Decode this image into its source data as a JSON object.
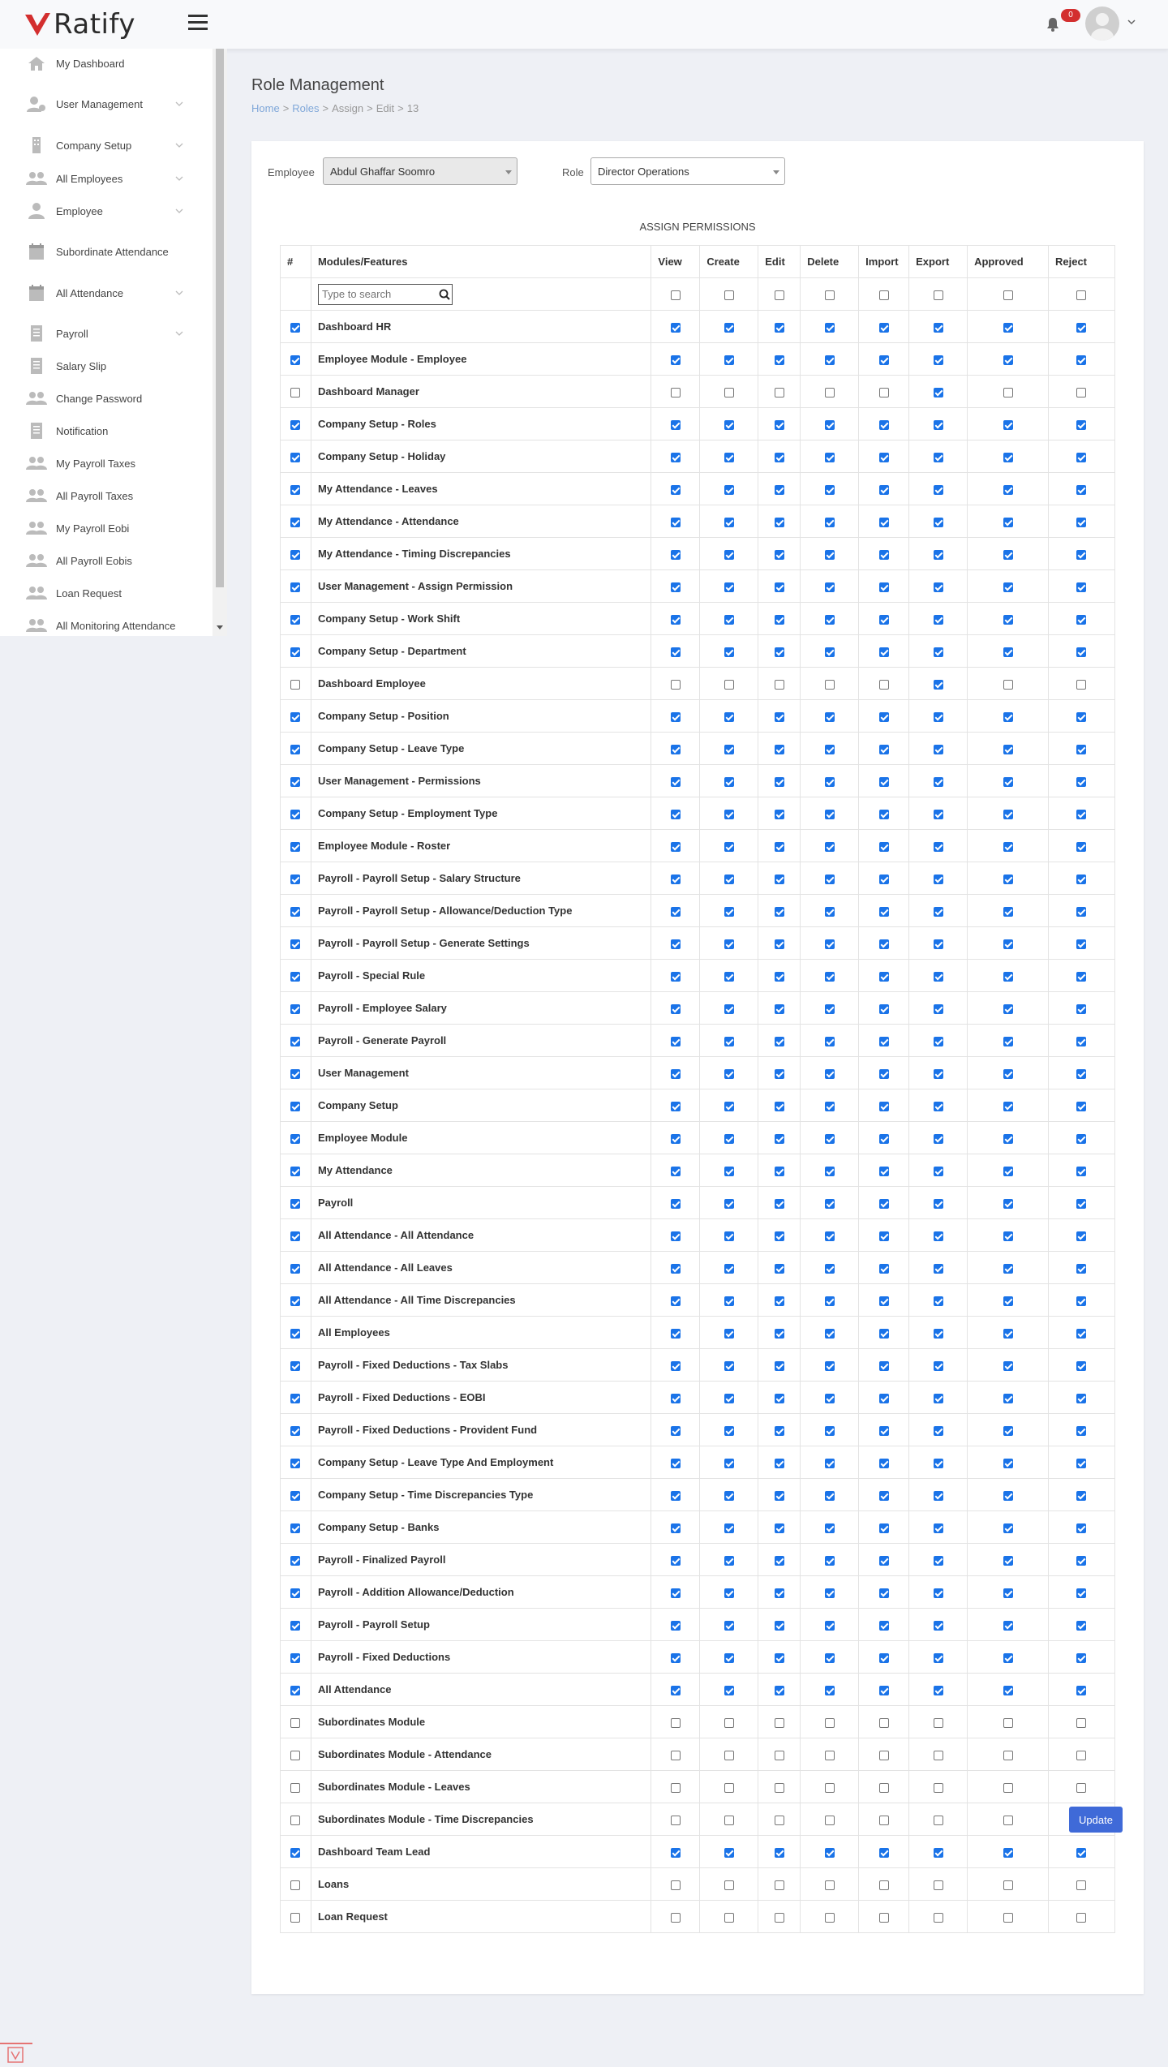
{
  "app": {
    "brand": "Ratify",
    "notification_count": "0",
    "accent": "#d32f2f"
  },
  "sidebar": {
    "items": [
      {
        "label": "My Dashboard",
        "icon": "home-icon",
        "chevron": false
      },
      {
        "label": "User Management",
        "icon": "user-cog-icon",
        "chevron": true
      },
      {
        "label": "Company Setup",
        "icon": "building-icon",
        "chevron": true
      },
      {
        "label": "All Employees",
        "icon": "users-icon",
        "chevron": true
      },
      {
        "label": "Employee",
        "icon": "user-icon",
        "chevron": true
      },
      {
        "label": "Subordinate Attendance",
        "icon": "calendar-icon",
        "chevron": false
      },
      {
        "label": "All Attendance",
        "icon": "calendar-icon",
        "chevron": true
      },
      {
        "label": "Payroll",
        "icon": "file-icon",
        "chevron": true
      },
      {
        "label": "Salary Slip",
        "icon": "file-icon",
        "chevron": false
      },
      {
        "label": "Change Password",
        "icon": "users-icon",
        "chevron": false
      },
      {
        "label": "Notification",
        "icon": "file-icon",
        "chevron": false
      },
      {
        "label": "My Payroll Taxes",
        "icon": "users-icon",
        "chevron": false
      },
      {
        "label": "All Payroll Taxes",
        "icon": "users-icon",
        "chevron": false
      },
      {
        "label": "My Payroll Eobi",
        "icon": "users-icon",
        "chevron": false
      },
      {
        "label": "All Payroll Eobis",
        "icon": "users-icon",
        "chevron": false
      },
      {
        "label": "Loan Request",
        "icon": "users-icon",
        "chevron": false
      },
      {
        "label": "All Monitoring Attendance",
        "icon": "users-icon",
        "chevron": false
      }
    ]
  },
  "page": {
    "title": "Role Management",
    "breadcrumb": [
      "Home",
      "Roles",
      "Assign",
      "Edit",
      "13"
    ]
  },
  "form": {
    "employee_label": "Employee",
    "employee_value": "Abdul Ghaffar Soomro",
    "role_label": "Role",
    "role_value": "Director Operations",
    "section_title": "ASSIGN PERMISSIONS",
    "search_placeholder": "Type to search",
    "update_label": "Update"
  },
  "table": {
    "headers": [
      "#",
      "Modules/Features",
      "View",
      "Create",
      "Edit",
      "Delete",
      "Import",
      "Export",
      "Approved",
      "Reject"
    ],
    "rows": [
      {
        "name": "Dashboard HR",
        "row": true,
        "perms": [
          true,
          true,
          true,
          true,
          true,
          true,
          true,
          true
        ]
      },
      {
        "name": "Employee Module - Employee",
        "row": true,
        "perms": [
          true,
          true,
          true,
          true,
          true,
          true,
          true,
          true
        ]
      },
      {
        "name": "Dashboard Manager",
        "row": false,
        "perms": [
          false,
          false,
          false,
          false,
          false,
          true,
          false,
          false
        ]
      },
      {
        "name": "Company Setup - Roles",
        "row": true,
        "perms": [
          true,
          true,
          true,
          true,
          true,
          true,
          true,
          true
        ]
      },
      {
        "name": "Company Setup - Holiday",
        "row": true,
        "perms": [
          true,
          true,
          true,
          true,
          true,
          true,
          true,
          true
        ]
      },
      {
        "name": "My Attendance - Leaves",
        "row": true,
        "perms": [
          true,
          true,
          true,
          true,
          true,
          true,
          true,
          true
        ]
      },
      {
        "name": "My Attendance - Attendance",
        "row": true,
        "perms": [
          true,
          true,
          true,
          true,
          true,
          true,
          true,
          true
        ]
      },
      {
        "name": "My Attendance - Timing Discrepancies",
        "row": true,
        "perms": [
          true,
          true,
          true,
          true,
          true,
          true,
          true,
          true
        ]
      },
      {
        "name": "User Management - Assign Permission",
        "row": true,
        "perms": [
          true,
          true,
          true,
          true,
          true,
          true,
          true,
          true
        ]
      },
      {
        "name": "Company Setup - Work Shift",
        "row": true,
        "perms": [
          true,
          true,
          true,
          true,
          true,
          true,
          true,
          true
        ]
      },
      {
        "name": "Company Setup - Department",
        "row": true,
        "perms": [
          true,
          true,
          true,
          true,
          true,
          true,
          true,
          true
        ]
      },
      {
        "name": "Dashboard Employee",
        "row": false,
        "perms": [
          false,
          false,
          false,
          false,
          false,
          true,
          false,
          false
        ]
      },
      {
        "name": "Company Setup - Position",
        "row": true,
        "perms": [
          true,
          true,
          true,
          true,
          true,
          true,
          true,
          true
        ]
      },
      {
        "name": "Company Setup - Leave Type",
        "row": true,
        "perms": [
          true,
          true,
          true,
          true,
          true,
          true,
          true,
          true
        ]
      },
      {
        "name": "User Management - Permissions",
        "row": true,
        "perms": [
          true,
          true,
          true,
          true,
          true,
          true,
          true,
          true
        ]
      },
      {
        "name": "Company Setup - Employment Type",
        "row": true,
        "perms": [
          true,
          true,
          true,
          true,
          true,
          true,
          true,
          true
        ]
      },
      {
        "name": "Employee Module - Roster",
        "row": true,
        "perms": [
          true,
          true,
          true,
          true,
          true,
          true,
          true,
          true
        ]
      },
      {
        "name": "Payroll - Payroll Setup - Salary Structure",
        "row": true,
        "perms": [
          true,
          true,
          true,
          true,
          true,
          true,
          true,
          true
        ]
      },
      {
        "name": "Payroll - Payroll Setup - Allowance/Deduction Type",
        "row": true,
        "perms": [
          true,
          true,
          true,
          true,
          true,
          true,
          true,
          true
        ]
      },
      {
        "name": "Payroll - Payroll Setup - Generate Settings",
        "row": true,
        "perms": [
          true,
          true,
          true,
          true,
          true,
          true,
          true,
          true
        ]
      },
      {
        "name": "Payroll - Special Rule",
        "row": true,
        "perms": [
          true,
          true,
          true,
          true,
          true,
          true,
          true,
          true
        ]
      },
      {
        "name": "Payroll - Employee Salary",
        "row": true,
        "perms": [
          true,
          true,
          true,
          true,
          true,
          true,
          true,
          true
        ]
      },
      {
        "name": "Payroll - Generate Payroll",
        "row": true,
        "perms": [
          true,
          true,
          true,
          true,
          true,
          true,
          true,
          true
        ]
      },
      {
        "name": "User Management",
        "row": true,
        "perms": [
          true,
          true,
          true,
          true,
          true,
          true,
          true,
          true
        ]
      },
      {
        "name": "Company Setup",
        "row": true,
        "perms": [
          true,
          true,
          true,
          true,
          true,
          true,
          true,
          true
        ]
      },
      {
        "name": "Employee Module",
        "row": true,
        "perms": [
          true,
          true,
          true,
          true,
          true,
          true,
          true,
          true
        ]
      },
      {
        "name": "My Attendance",
        "row": true,
        "perms": [
          true,
          true,
          true,
          true,
          true,
          true,
          true,
          true
        ]
      },
      {
        "name": "Payroll",
        "row": true,
        "perms": [
          true,
          true,
          true,
          true,
          true,
          true,
          true,
          true
        ]
      },
      {
        "name": "All Attendance - All Attendance",
        "row": true,
        "perms": [
          true,
          true,
          true,
          true,
          true,
          true,
          true,
          true
        ]
      },
      {
        "name": "All Attendance - All Leaves",
        "row": true,
        "perms": [
          true,
          true,
          true,
          true,
          true,
          true,
          true,
          true
        ]
      },
      {
        "name": "All Attendance - All Time Discrepancies",
        "row": true,
        "perms": [
          true,
          true,
          true,
          true,
          true,
          true,
          true,
          true
        ]
      },
      {
        "name": "All Employees",
        "row": true,
        "perms": [
          true,
          true,
          true,
          true,
          true,
          true,
          true,
          true
        ]
      },
      {
        "name": "Payroll - Fixed Deductions - Tax Slabs",
        "row": true,
        "perms": [
          true,
          true,
          true,
          true,
          true,
          true,
          true,
          true
        ]
      },
      {
        "name": "Payroll - Fixed Deductions - EOBI",
        "row": true,
        "perms": [
          true,
          true,
          true,
          true,
          true,
          true,
          true,
          true
        ]
      },
      {
        "name": "Payroll - Fixed Deductions - Provident Fund",
        "row": true,
        "perms": [
          true,
          true,
          true,
          true,
          true,
          true,
          true,
          true
        ]
      },
      {
        "name": "Company Setup - Leave Type And Employment",
        "row": true,
        "perms": [
          true,
          true,
          true,
          true,
          true,
          true,
          true,
          true
        ]
      },
      {
        "name": "Company Setup - Time Discrepancies Type",
        "row": true,
        "perms": [
          true,
          true,
          true,
          true,
          true,
          true,
          true,
          true
        ]
      },
      {
        "name": "Company Setup - Banks",
        "row": true,
        "perms": [
          true,
          true,
          true,
          true,
          true,
          true,
          true,
          true
        ]
      },
      {
        "name": "Payroll - Finalized Payroll",
        "row": true,
        "perms": [
          true,
          true,
          true,
          true,
          true,
          true,
          true,
          true
        ]
      },
      {
        "name": "Payroll - Addition Allowance/Deduction",
        "row": true,
        "perms": [
          true,
          true,
          true,
          true,
          true,
          true,
          true,
          true
        ]
      },
      {
        "name": "Payroll - Payroll Setup",
        "row": true,
        "perms": [
          true,
          true,
          true,
          true,
          true,
          true,
          true,
          true
        ]
      },
      {
        "name": "Payroll - Fixed Deductions",
        "row": true,
        "perms": [
          true,
          true,
          true,
          true,
          true,
          true,
          true,
          true
        ]
      },
      {
        "name": "All Attendance",
        "row": true,
        "perms": [
          true,
          true,
          true,
          true,
          true,
          true,
          true,
          true
        ]
      },
      {
        "name": "Subordinates Module",
        "row": false,
        "perms": [
          false,
          false,
          false,
          false,
          false,
          false,
          false,
          false
        ]
      },
      {
        "name": "Subordinates Module - Attendance",
        "row": false,
        "perms": [
          false,
          false,
          false,
          false,
          false,
          false,
          false,
          false
        ]
      },
      {
        "name": "Subordinates Module - Leaves",
        "row": false,
        "perms": [
          false,
          false,
          false,
          false,
          false,
          false,
          false,
          false
        ]
      },
      {
        "name": "Subordinates Module - Time Discrepancies",
        "row": false,
        "perms": [
          false,
          false,
          false,
          false,
          false,
          false,
          false,
          false
        ]
      },
      {
        "name": "Dashboard Team Lead",
        "row": true,
        "perms": [
          true,
          true,
          true,
          true,
          true,
          true,
          true,
          true
        ]
      },
      {
        "name": "Loans",
        "row": false,
        "perms": [
          false,
          false,
          false,
          false,
          false,
          false,
          false,
          false
        ]
      },
      {
        "name": "Loan Request",
        "row": false,
        "perms": [
          false,
          false,
          false,
          false,
          false,
          false,
          false,
          false
        ]
      }
    ]
  }
}
